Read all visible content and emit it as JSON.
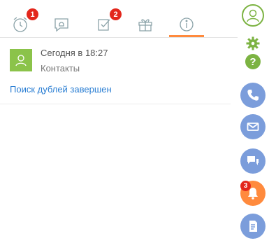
{
  "tabs": [
    {
      "name": "reminders",
      "icon": "alarm-clock-icon",
      "badge": "1"
    },
    {
      "name": "feed",
      "icon": "chat-bubble-icon",
      "badge": ""
    },
    {
      "name": "tasks",
      "icon": "checkbox-icon",
      "badge": "2"
    },
    {
      "name": "anniversaries",
      "icon": "gift-icon",
      "badge": ""
    },
    {
      "name": "info",
      "icon": "info-icon",
      "badge": "",
      "active": true
    }
  ],
  "notification": {
    "time": "Сегодня в 18:27",
    "section": "Контакты",
    "message": "Поиск дублей завершен",
    "avatar_icon": "user-icon"
  },
  "sidebar": {
    "items": [
      {
        "name": "profile",
        "icon": "user-avatar-icon"
      },
      {
        "name": "settings",
        "icon": "gear-icon"
      },
      {
        "name": "help",
        "icon": "help-icon",
        "label": "?"
      },
      {
        "name": "calls",
        "icon": "phone-icon"
      },
      {
        "name": "email",
        "icon": "mail-icon"
      },
      {
        "name": "feed",
        "icon": "chat-icon"
      },
      {
        "name": "notifications",
        "icon": "bell-icon",
        "badge": "3"
      },
      {
        "name": "documents",
        "icon": "document-icon"
      }
    ]
  },
  "colors": {
    "accent": "#ff8a3d",
    "badge": "#e3271c",
    "sidebar_button": "#7b9ddb",
    "green": "#7cb342",
    "link": "#2a7ed3"
  }
}
